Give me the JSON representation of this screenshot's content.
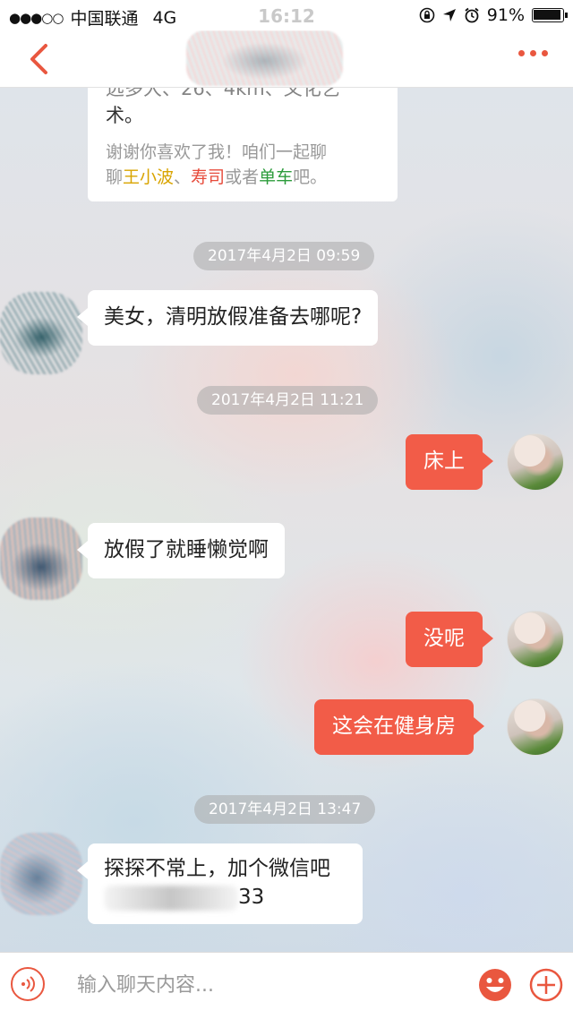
{
  "status_bar": {
    "carrier": "中国联通",
    "network": "4G",
    "time": "16:12",
    "battery": "91%"
  },
  "intro_card": {
    "top_partial": "远多大、26、4km、文化艺",
    "top_line2": "术。",
    "line1": "谢谢你喜欢了我！咱们一起聊",
    "line2_prefix": "聊",
    "topic1": "王小波",
    "sep1": "、",
    "topic2": "寿司",
    "line2_mid": "或者",
    "topic3": "单车",
    "line2_suffix": "吧。"
  },
  "messages": [
    {
      "type": "timestamp",
      "text": "2017年4月2日 09:59"
    },
    {
      "type": "incoming",
      "text": "美女，清明放假准备去哪呢?"
    },
    {
      "type": "timestamp",
      "text": "2017年4月2日 11:21"
    },
    {
      "type": "outgoing",
      "text": "床上"
    },
    {
      "type": "incoming",
      "text": "放假了就睡懒觉啊"
    },
    {
      "type": "outgoing",
      "text": "没呢"
    },
    {
      "type": "outgoing",
      "text": "这会在健身房"
    },
    {
      "type": "timestamp",
      "text": "2017年4月2日 13:47"
    },
    {
      "type": "incoming",
      "text": "探探不常上，加个微信吧",
      "text_line2_visible": "33"
    }
  ],
  "input": {
    "placeholder": "输入聊天内容..."
  },
  "colors": {
    "accent": "#e9573f",
    "outgoing_bubble": "#f25c48"
  },
  "icons": {
    "back": "chevron-left-icon",
    "more": "more-dots-icon",
    "voice": "voice-icon",
    "emoji": "emoji-icon",
    "plus": "plus-icon"
  }
}
